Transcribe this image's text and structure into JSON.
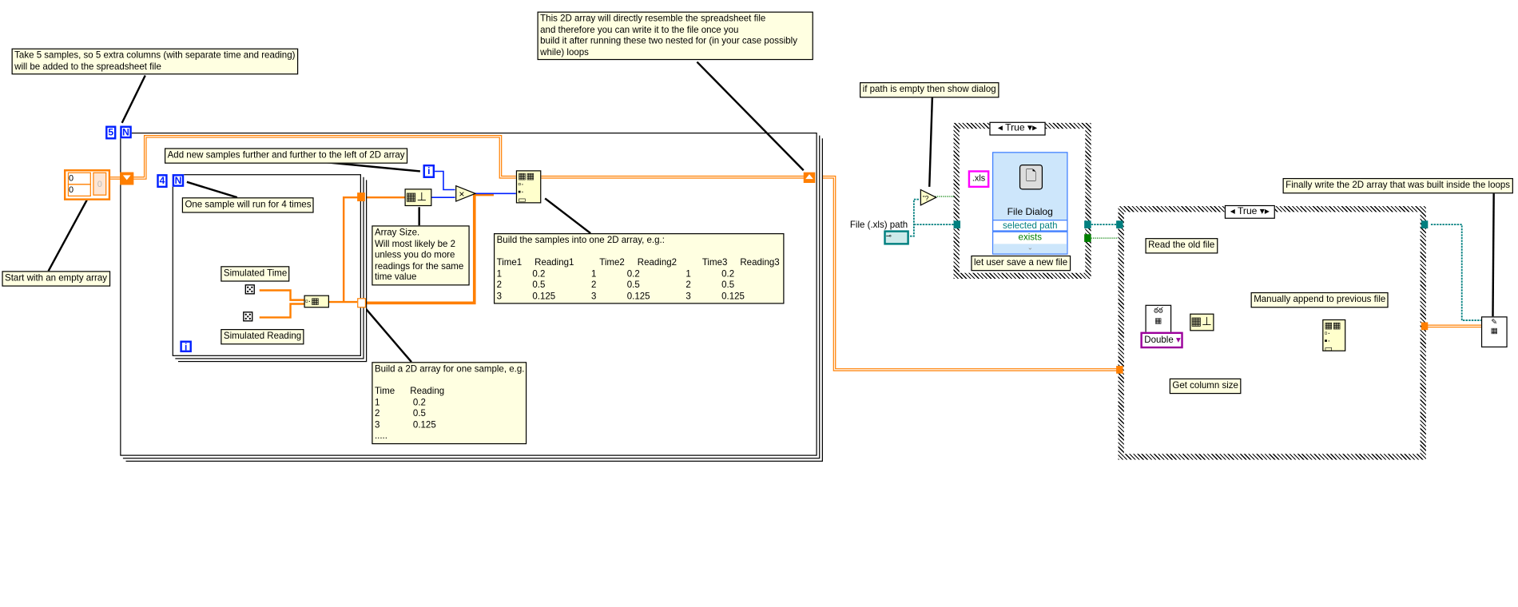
{
  "notes": {
    "take_samples": "Take 5 samples, so 5 extra columns (with separate time and reading)\nwill be added to the spreadsheet file",
    "empty_array": "Start with an empty array",
    "add_left": "Add new samples further and further to the left of 2D array",
    "one_sample": "One sample will run for 4 times",
    "array_size": "Array Size.\nWill most likely be 2\nunless you do more\nreadings for the same\ntime value",
    "build_samples": "Build the samples into one 2D array, e.g.:\n\nTime1     Reading1          Time2     Reading2          Time3     Reading3\n1            0.2                  1            0.2                  1            0.2\n2            0.5                  2            0.5                  2            0.5\n3            0.125              3            0.125              3            0.125",
    "build_one": "Build a 2D array for one sample, e.g.\n\nTime      Reading\n1             0.2\n2             0.5\n3             0.125\n.....",
    "resemble": "This 2D array will directly resemble the spreadsheet file\nand therefore you can write it to the file once you\nbuild it after running these two nested for (in your case possibly\nwhile) loops",
    "path_empty": "if path is empty then show dialog",
    "save_new": "let user save a new file",
    "read_old": "Read the old file",
    "column_size": "Get column size",
    "append": "Manually append to previous file",
    "finally_write": "Finally write the 2D array that was built inside the loops"
  },
  "outer_loop": {
    "count": "5",
    "n_label": "N"
  },
  "inner_loop": {
    "count": "4",
    "n_label": "N",
    "i_label": "i"
  },
  "outer_i_label": "i",
  "array_constant": {
    "index1": "0",
    "index2": "0",
    "element": "0"
  },
  "labels": {
    "simulated_time": "Simulated Time",
    "simulated_reading": "Simulated Reading",
    "file_path": "File (.xls) path"
  },
  "case1": {
    "selector": "True"
  },
  "case2": {
    "selector": "True"
  },
  "file_dialog": {
    "title": "File Dialog",
    "output1": "selected path",
    "output2": "exists",
    "pattern": ".xls"
  },
  "double_constant": "Double",
  "multiply_symbol": "×",
  "colors": {
    "array_wire": "#ff7f00",
    "int_wire": "#0020ff",
    "path_wire": "#007f7f",
    "bool_wire": "#007f00",
    "note_bg": "#ffffe1"
  }
}
